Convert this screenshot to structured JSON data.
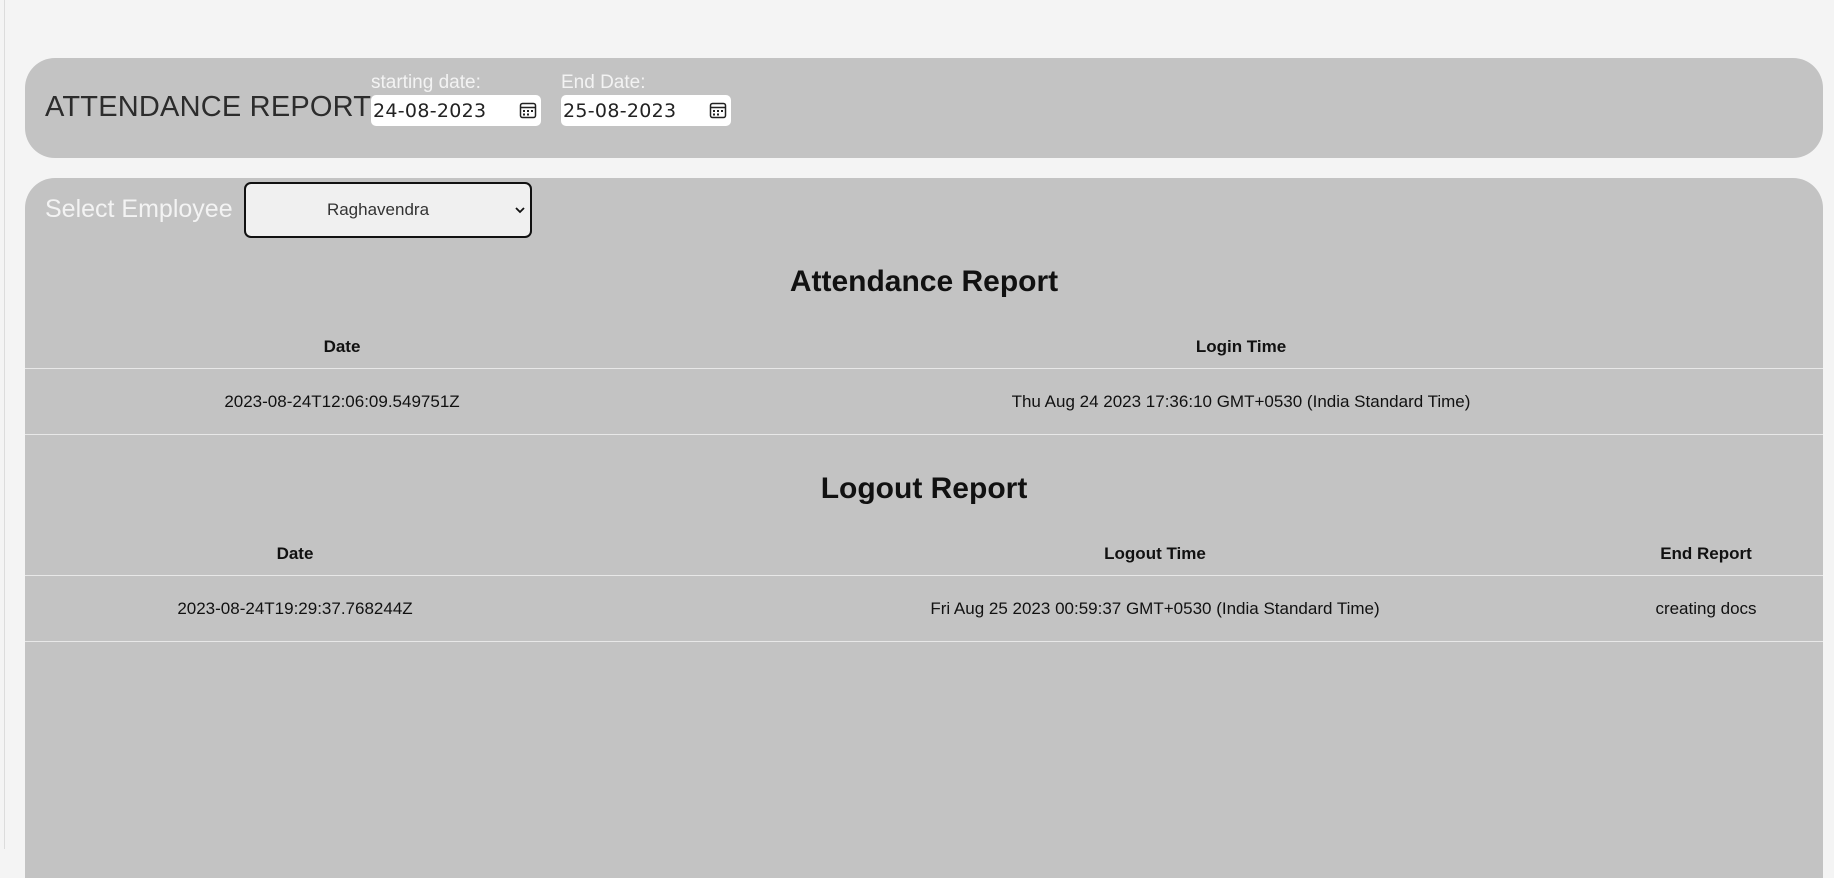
{
  "header": {
    "title": "ATTENDANCE REPORT",
    "start_date": {
      "label": "starting date:",
      "value": "24-08-2023",
      "icon": "calendar-icon"
    },
    "end_date": {
      "label": "End Date:",
      "value": "25-08-2023",
      "icon": "calendar-icon"
    }
  },
  "employee": {
    "label": "Select Employee",
    "selected": "Raghavendra"
  },
  "attendance": {
    "title": "Attendance Report",
    "columns": [
      "Date",
      "Login Time"
    ],
    "rows": [
      [
        "2023-08-24T12:06:09.549751Z",
        "Thu Aug 24 2023 17:36:10 GMT+0530 (India Standard Time)"
      ]
    ]
  },
  "logout": {
    "title": "Logout Report",
    "columns": [
      "Date",
      "Logout Time",
      "End Report"
    ],
    "rows": [
      [
        "2023-08-24T19:29:37.768244Z",
        "Fri Aug 25 2023 00:59:37 GMT+0530 (India Standard Time)",
        "creating docs"
      ]
    ]
  }
}
